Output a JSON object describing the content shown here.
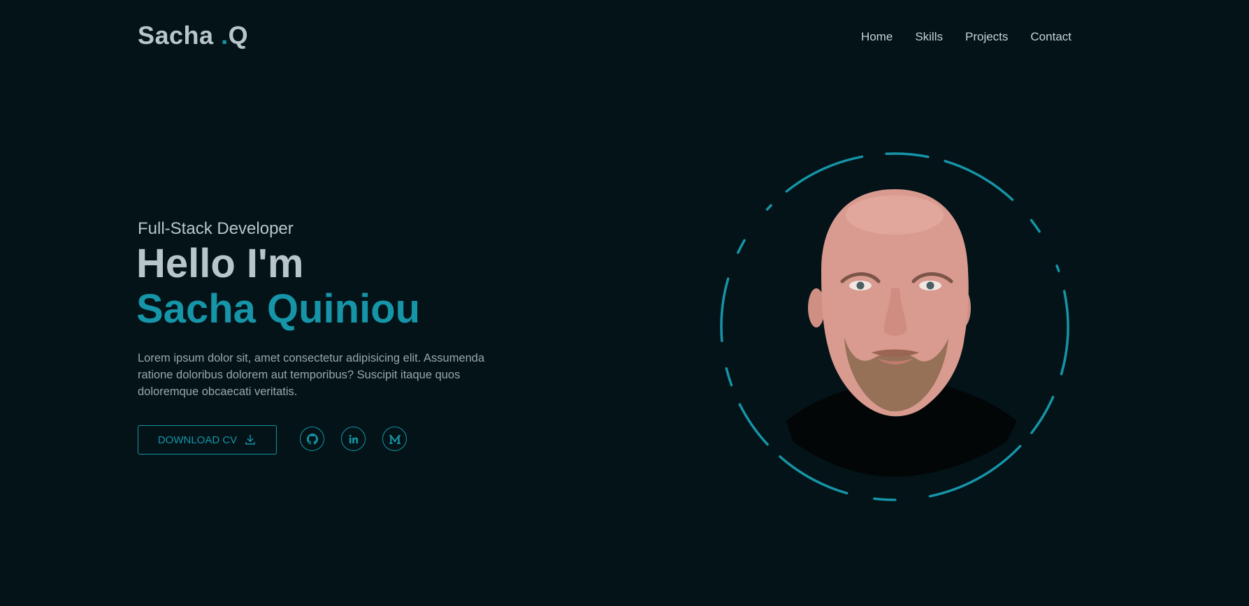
{
  "header": {
    "logo_main": "Sacha ",
    "logo_dot": ".",
    "logo_suffix": "Q",
    "nav": [
      "Home",
      "Skills",
      "Projects",
      "Contact"
    ]
  },
  "hero": {
    "subtitle": "Full-Stack Developer",
    "greeting": "Hello I'm",
    "name": "Sacha Quiniou",
    "description": "Lorem ipsum dolor sit, amet consectetur adipisicing elit. Assumenda ratione doloribus dolorem aut temporibus? Suscipit itaque quos doloremque obcaecati veritatis.",
    "cv_button": "DOWNLOAD CV",
    "socials": [
      "github-icon",
      "linkedin-icon",
      "medium-icon"
    ]
  },
  "colors": {
    "background": "#031317",
    "accent": "#1694a8",
    "text": "#b9c6c9"
  }
}
